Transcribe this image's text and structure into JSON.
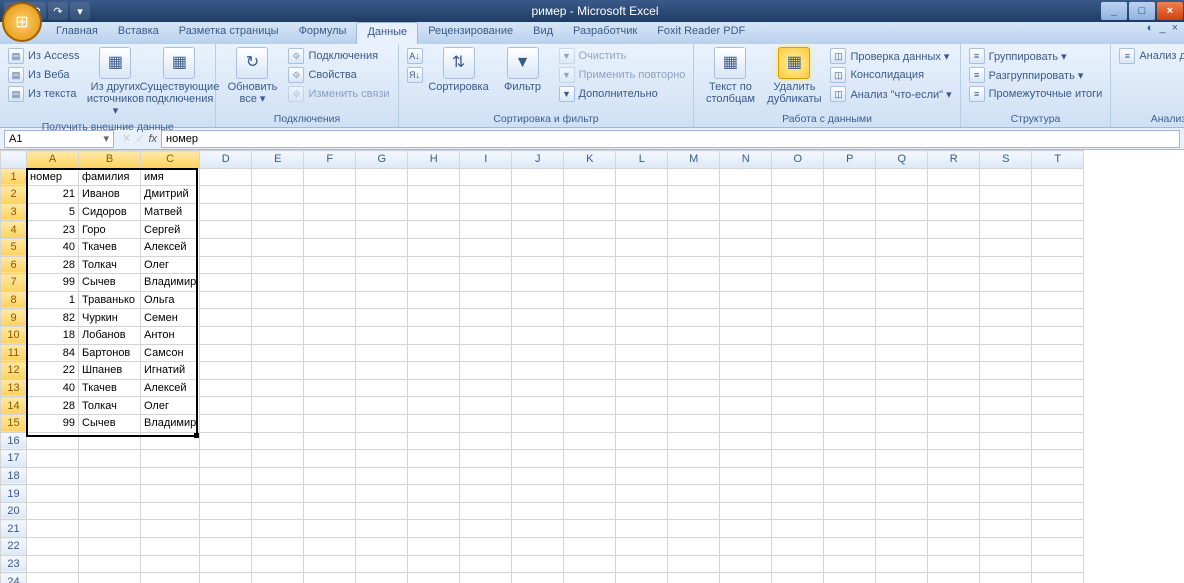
{
  "title": "ример - Microsoft Excel",
  "tabs": [
    "Главная",
    "Вставка",
    "Разметка страницы",
    "Формулы",
    "Данные",
    "Рецензирование",
    "Вид",
    "Разработчик",
    "Foxit Reader PDF"
  ],
  "active_tab": 4,
  "ribbon": {
    "groups": [
      {
        "label": "Получить внешние данные",
        "small": [
          "Из Access",
          "Из Веба",
          "Из текста"
        ],
        "big": [
          {
            "t": "Из других источников ▾"
          },
          {
            "t": "Существующие подключения"
          }
        ]
      },
      {
        "label": "Подключения",
        "big": [
          {
            "t": "Обновить все ▾"
          }
        ],
        "small": [
          "Подключения",
          "Свойства",
          "Изменить связи"
        ]
      },
      {
        "label": "Сортировка и фильтр",
        "big": [
          {
            "t": "А↓Я"
          },
          {
            "t": "Сортировка"
          },
          {
            "t": "Фильтр"
          }
        ],
        "small": [
          "Очистить",
          "Применить повторно",
          "Дополнительно"
        ]
      },
      {
        "label": "Работа с данными",
        "big": [
          {
            "t": "Текст по столбцам"
          },
          {
            "t": "Удалить дубликаты",
            "hl": true
          }
        ],
        "small": [
          "Проверка данных ▾",
          "Консолидация",
          "Анализ \"что-если\" ▾"
        ]
      },
      {
        "label": "Структура",
        "small": [
          "Группировать ▾",
          "Разгруппировать ▾",
          "Промежуточные итоги"
        ]
      },
      {
        "label": "Анализ",
        "small": [
          "Анализ данных"
        ]
      }
    ]
  },
  "namebox": "A1",
  "formula": "номер",
  "columns": [
    "A",
    "B",
    "C",
    "D",
    "E",
    "F",
    "G",
    "H",
    "I",
    "J",
    "K",
    "L",
    "M",
    "N",
    "O",
    "P",
    "Q",
    "R",
    "S",
    "T"
  ],
  "sel_cols": [
    "A",
    "B",
    "C"
  ],
  "rows": 24,
  "sel_rows": 15,
  "data": [
    [
      "номер",
      "фамилия",
      "имя"
    ],
    [
      21,
      "Иванов",
      "Дмитрий"
    ],
    [
      5,
      "Сидоров",
      "Матвей"
    ],
    [
      23,
      "Горо",
      "Сергей"
    ],
    [
      40,
      "Ткачев",
      "Алексей"
    ],
    [
      28,
      "Толкач",
      "Олег"
    ],
    [
      99,
      "Сычев",
      "Владимир"
    ],
    [
      1,
      "Траванько",
      "Ольга"
    ],
    [
      82,
      "Чуркин",
      "Семен"
    ],
    [
      18,
      "Лобанов",
      "Антон"
    ],
    [
      84,
      "Бартонов",
      "Самсон"
    ],
    [
      22,
      "Шпанев",
      "Игнатий"
    ],
    [
      40,
      "Ткачев",
      "Алексей"
    ],
    [
      28,
      "Толкач",
      "Олег"
    ],
    [
      99,
      "Сычев",
      "Владимир"
    ]
  ]
}
